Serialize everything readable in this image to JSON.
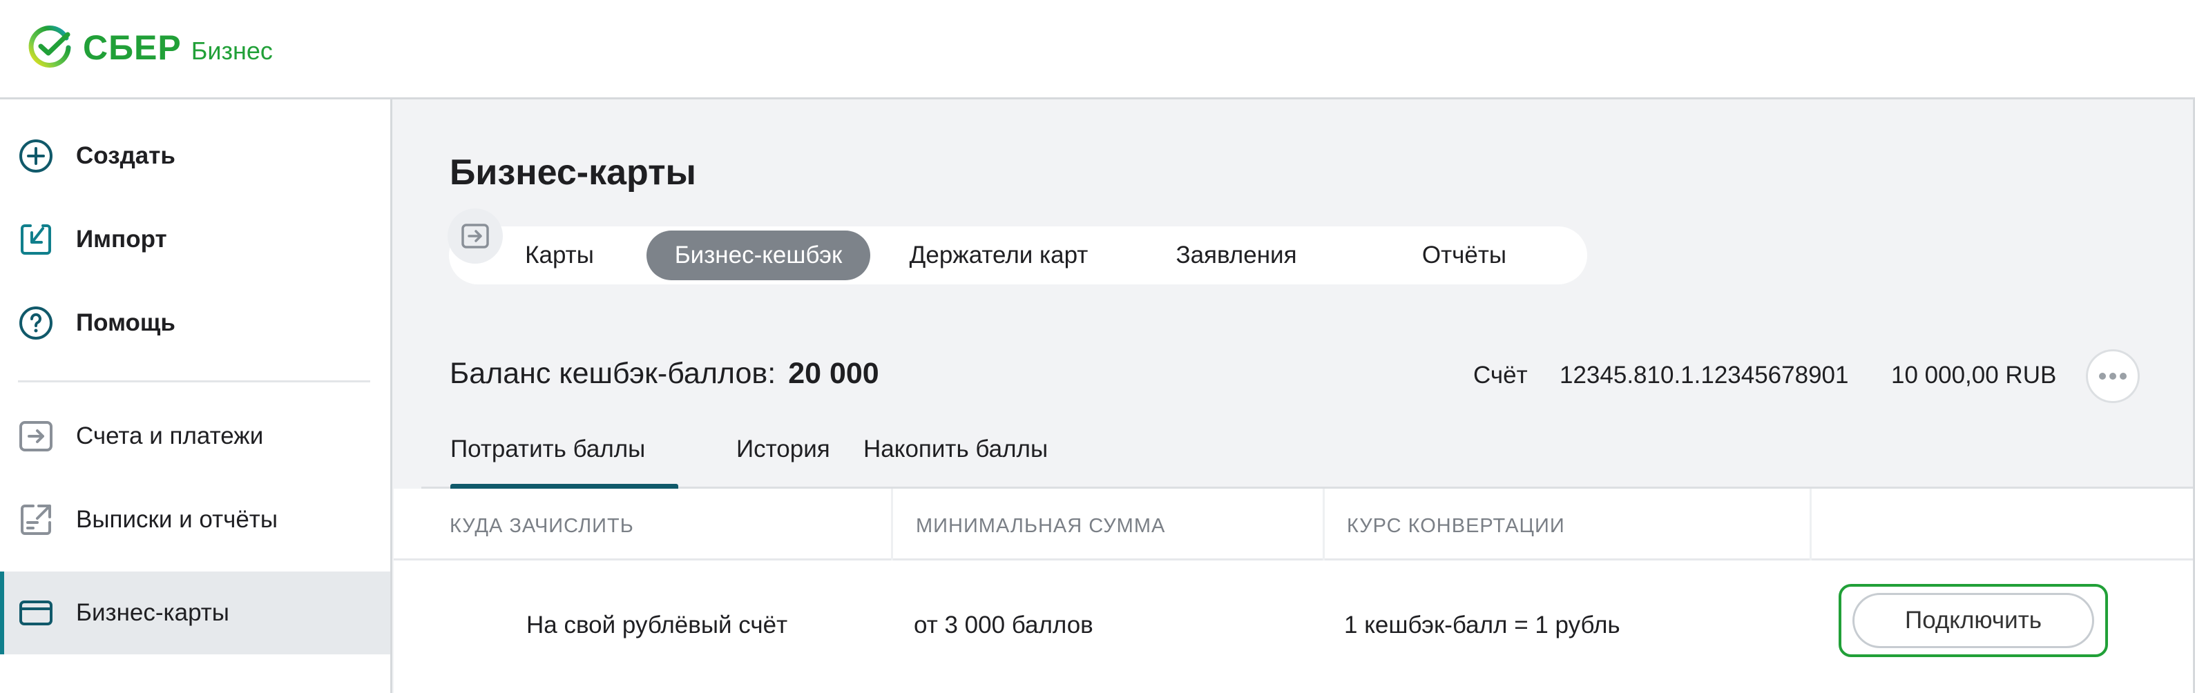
{
  "header": {
    "logo_main": "СБЕР",
    "logo_sub": "Бизнес"
  },
  "sidebar": {
    "items": [
      {
        "label": "Создать",
        "icon": "plus-circle-icon"
      },
      {
        "label": "Импорт",
        "icon": "import-icon"
      },
      {
        "label": "Помощь",
        "icon": "help-circle-icon"
      },
      {
        "label": "Счета и платежи",
        "icon": "account-arrow-icon"
      },
      {
        "label": "Выписки и отчёты",
        "icon": "statement-export-icon"
      },
      {
        "label": "Бизнес-карты",
        "icon": "card-icon",
        "active": true
      }
    ]
  },
  "main": {
    "title": "Бизнес-карты",
    "tabs": [
      {
        "label": "Карты"
      },
      {
        "label": "Бизнес-кешбэк",
        "active": true
      },
      {
        "label": "Держатели карт"
      },
      {
        "label": "Заявления"
      },
      {
        "label": "Отчёты"
      }
    ],
    "balance": {
      "label": "Баланс кешбэк-баллов:",
      "value": "20 000"
    },
    "account": {
      "label": "Счёт",
      "number": "12345.810.1.12345678901",
      "amount": "10 000,00 RUB"
    },
    "subtabs": [
      {
        "label": "Потратить баллы",
        "active": true
      },
      {
        "label": "История"
      },
      {
        "label": "Накопить баллы"
      }
    ],
    "table": {
      "headers": [
        "КУДА ЗАЧИСЛИТЬ",
        "МИНИМАЛЬНАЯ СУММА",
        "КУРС КОНВЕРТАЦИИ"
      ],
      "rows": [
        {
          "destination": "На свой рублёвый счёт",
          "min_sum": "от 3 000 баллов",
          "rate": "1 кешбэк-балл = 1 рубль",
          "action": "Подключить",
          "icon": "account-arrow-icon"
        }
      ]
    }
  },
  "colors": {
    "brand": "#21a038",
    "accent": "#107f8c",
    "active_tab": "#7d838a",
    "background": "#f2f3f5"
  }
}
